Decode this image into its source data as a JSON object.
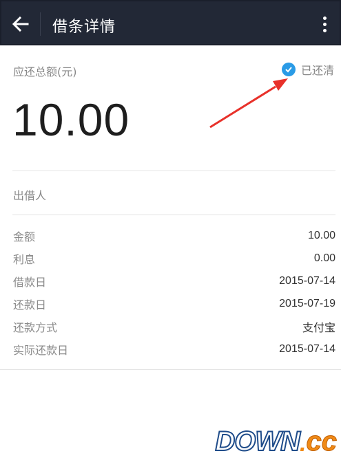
{
  "header": {
    "title": "借条详情",
    "back_icon": "arrow-left-icon",
    "more_icon": "more-vertical-icon",
    "bg_color": "#222836"
  },
  "summary": {
    "total_label": "应还总额(元)",
    "amount": "10.00",
    "status": "已还清",
    "status_icon": "check-circle-icon",
    "status_color": "#2a9be6"
  },
  "lender": {
    "label": "出借人"
  },
  "details": [
    {
      "label": "金额",
      "value": "10.00"
    },
    {
      "label": "利息",
      "value": "0.00"
    },
    {
      "label": "借款日",
      "value": "2015-07-14"
    },
    {
      "label": "还款日",
      "value": "2015-07-19"
    },
    {
      "label": "还款方式",
      "value": "支付宝"
    },
    {
      "label": "实际还款日",
      "value": "2015-07-14"
    }
  ],
  "annotation": {
    "arrow_color": "#e8312a"
  },
  "watermark": {
    "main": "DOWN",
    "dot": ".",
    "suffix": "cc"
  }
}
